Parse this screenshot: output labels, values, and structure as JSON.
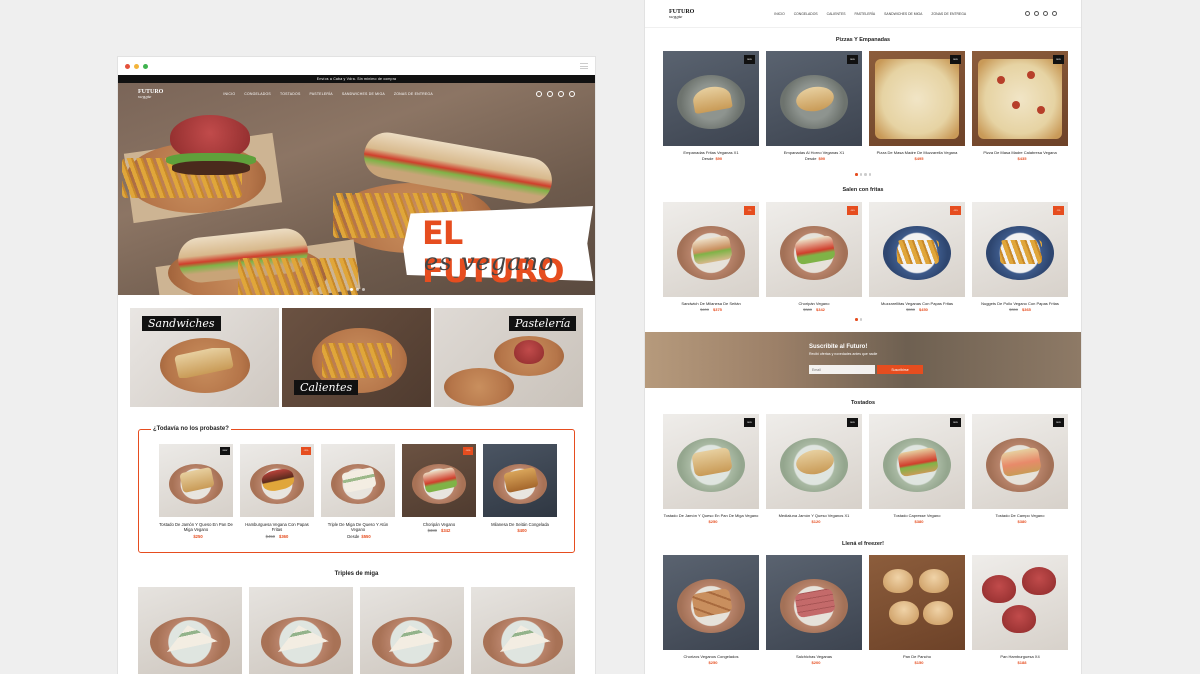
{
  "colors": {
    "accent": "#e64d1f",
    "dark": "#111111",
    "background": "#efefef"
  },
  "left": {
    "promo_bar": "Envíos a Caba y Vdra. Sin mínimo de compra",
    "logo": {
      "name": "FUTURO",
      "sub": "veggie"
    },
    "menu": [
      "Inicio",
      "Congelados",
      "Tostados",
      "Pastelería",
      "Sandwiches de miga",
      "Zonas de entrega"
    ],
    "icons": [
      "search-icon",
      "user-icon",
      "heart-icon",
      "cart-icon"
    ],
    "hero": {
      "headline": "EL FUTURO",
      "script": "es vegano"
    },
    "categories": [
      "Sandwiches",
      "Calientes",
      "Pastelería"
    ],
    "probaste": {
      "title": "¿Todavía no los probaste?",
      "products": [
        {
          "name": "Tostado De Jamón Y Queso En Pan De Miga Vegano",
          "old": "",
          "from": "",
          "price": "$250",
          "tag": "dark"
        },
        {
          "name": "Hamburguesa Vegana Con Papas Fritas",
          "old": "$450",
          "from": "",
          "price": "$360",
          "tag": "orange"
        },
        {
          "name": "Triple De Miga De Queso Y Atún Vegano",
          "old": "",
          "from": "Desde",
          "price": "$550",
          "tag": ""
        },
        {
          "name": "Choripán Vegano",
          "old": "$380",
          "from": "",
          "price": "$342",
          "tag": "orange"
        },
        {
          "name": "Milanesa De Seitán Congelada",
          "old": "",
          "from": "",
          "price": "$400",
          "tag": ""
        }
      ]
    },
    "triples_title": "Triples de miga"
  },
  "right": {
    "logo": {
      "name": "FUTURO",
      "sub": "veggie"
    },
    "menu": [
      "Inicio",
      "Congelados",
      "Calientes",
      "Pastelería",
      "Sandwiches de miga",
      "Zonas de entrega"
    ],
    "sections": [
      {
        "title": "Pizzas Y Empanadas",
        "products": [
          {
            "name": "Empanadas Fritas Veganas X1",
            "old": "",
            "from": "Desde",
            "price": "$90"
          },
          {
            "name": "Empanadas Al Horno Veganas X1",
            "old": "",
            "from": "Desde",
            "price": "$90"
          },
          {
            "name": "Pizza De Masa Madre De Muzzarella Vegana",
            "old": "",
            "from": "",
            "price": "$495"
          },
          {
            "name": "Pizza De Masa Madre Calabresa Vegana",
            "old": "",
            "from": "",
            "price": "$435"
          }
        ]
      },
      {
        "title": "Salen con fritas",
        "products": [
          {
            "name": "Sandwich De Milanesa De Seitán",
            "old": "$400",
            "from": "",
            "price": "$375"
          },
          {
            "name": "Choripán Vegano",
            "old": "$380",
            "from": "",
            "price": "$342"
          },
          {
            "name": "Muzzarellitas Veganas Con Papas Fritas",
            "old": "$530",
            "from": "",
            "price": "$450"
          },
          {
            "name": "Nuggets De Pollo Vegano Con Papas Fritas",
            "old": "$350",
            "from": "",
            "price": "$365"
          }
        ]
      },
      {
        "title": "Tostados",
        "products": [
          {
            "name": "Tostado De Jamón Y Queso En Pan De Miga Vegano",
            "old": "",
            "from": "",
            "price": "$250"
          },
          {
            "name": "Medialuna Jamón Y Queso Veganos X1",
            "old": "",
            "from": "",
            "price": "$120"
          },
          {
            "name": "Tostado Capresse Vegano",
            "old": "",
            "from": "",
            "price": "$380"
          },
          {
            "name": "Tostado De Campo Vegano",
            "old": "",
            "from": "",
            "price": "$380"
          }
        ]
      },
      {
        "title": "Llená el freezer!",
        "products": [
          {
            "name": "Chorizos Veganos Congelados",
            "old": "",
            "from": "",
            "price": "$250"
          },
          {
            "name": "Salchichas Veganas",
            "old": "",
            "from": "",
            "price": "$200"
          },
          {
            "name": "Pan De Pancho",
            "old": "",
            "from": "",
            "price": "$150"
          },
          {
            "name": "Pan Hamburguesa X4",
            "old": "",
            "from": "",
            "price": "$188"
          }
        ]
      }
    ],
    "newsletter": {
      "title": "Suscribite al Futuro!",
      "subtitle": "Recibí ofertas y novedades antes que nadie",
      "placeholder": "Email",
      "button": "Suscribirse"
    }
  }
}
